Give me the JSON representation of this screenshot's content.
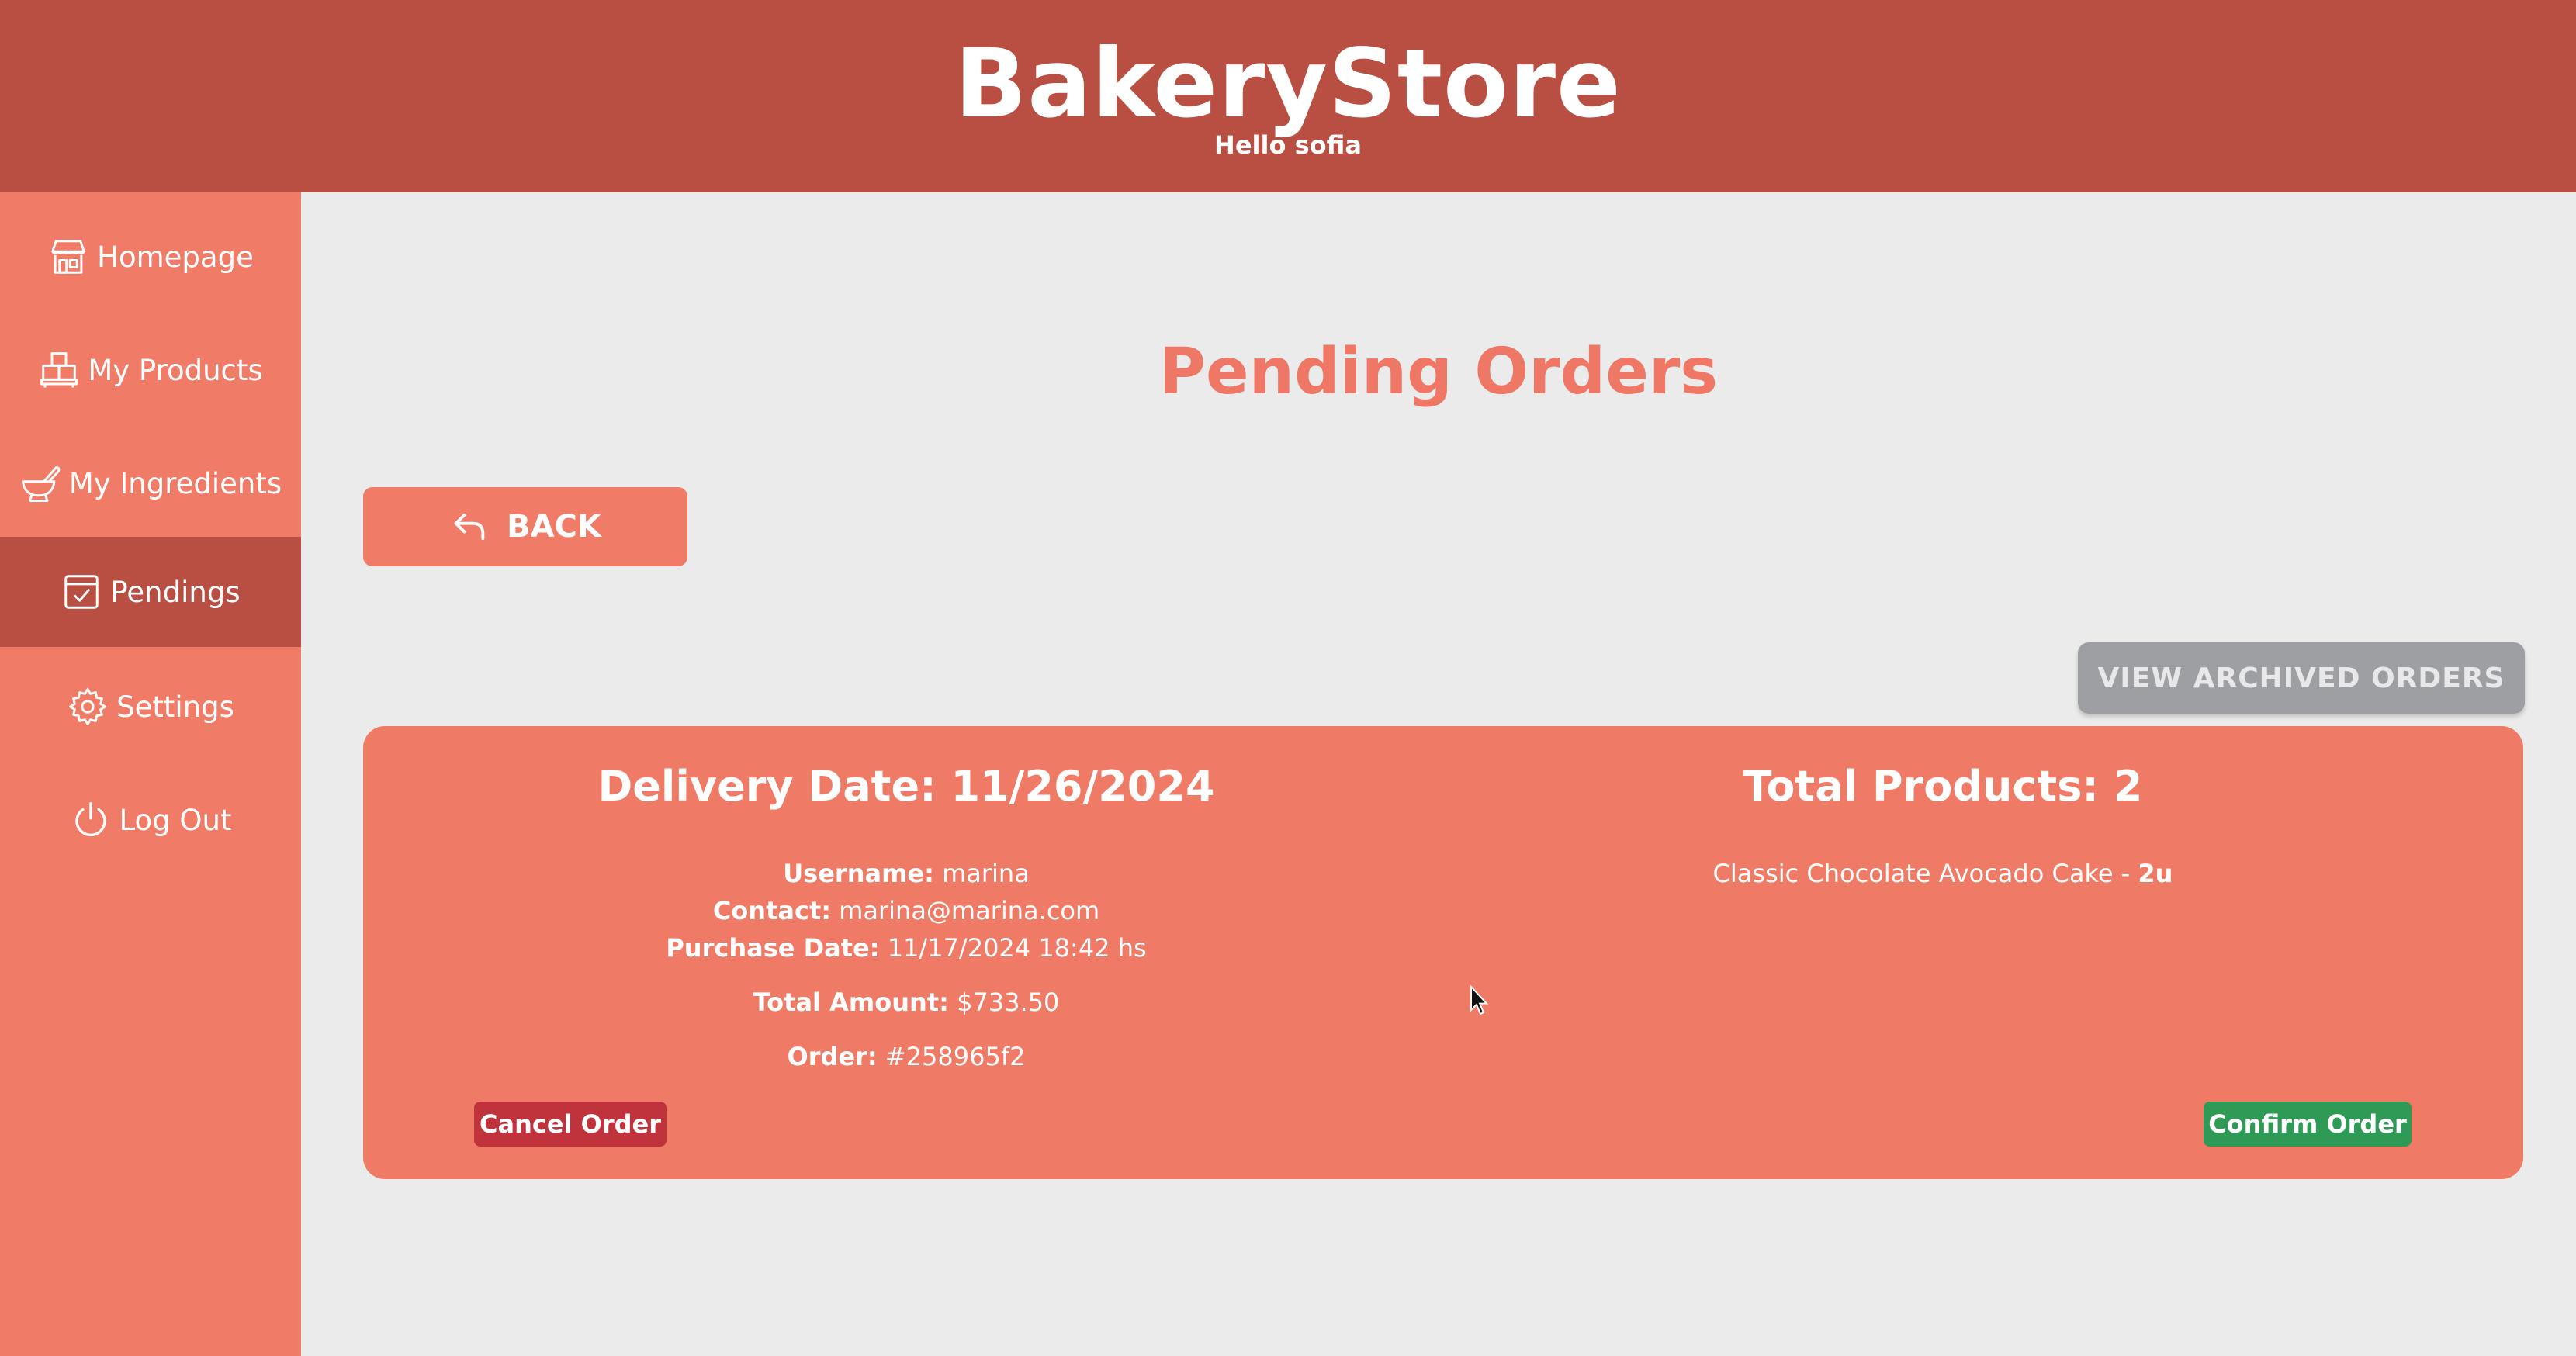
{
  "header": {
    "title": "BakeryStore",
    "greeting": "Hello sofia"
  },
  "sidebar": {
    "items": [
      {
        "label": "Homepage",
        "icon": "store-icon"
      },
      {
        "label": "My Products",
        "icon": "boxes-icon"
      },
      {
        "label": "My Ingredients",
        "icon": "mortar-bowl-icon"
      },
      {
        "label": "Pendings",
        "icon": "checkbox-icon",
        "active": true
      },
      {
        "label": "Settings",
        "icon": "gear-icon"
      },
      {
        "label": "Log Out",
        "icon": "power-icon"
      }
    ]
  },
  "main": {
    "title": "Pending Orders",
    "back_label": "BACK",
    "archived_label": "VIEW ARCHIVED ORDERS",
    "order": {
      "delivery_heading": "Delivery Date: 11/26/2024",
      "username_label": "Username:",
      "username": "marina",
      "contact_label": "Contact:",
      "contact": "marina@marina.com",
      "purchase_label": "Purchase Date:",
      "purchase_date": "11/17/2024 18:42 hs",
      "total_label": "Total Amount:",
      "total": "$733.50",
      "order_label": "Order:",
      "order_id": "#258965f2",
      "products_heading": "Total Products: 2",
      "products": [
        {
          "name": "Classic Chocolate Avocado Cake",
          "separator": " - ",
          "qty": "2u"
        }
      ],
      "cancel_label": "Cancel Order",
      "confirm_label": "Confirm Order"
    }
  },
  "colors": {
    "header": "#b94f42",
    "sidebar": "#f07c68",
    "accent": "#ee7865",
    "cancel": "#c0323c",
    "confirm": "#2e9a56",
    "archived": "#9d9fa3"
  }
}
